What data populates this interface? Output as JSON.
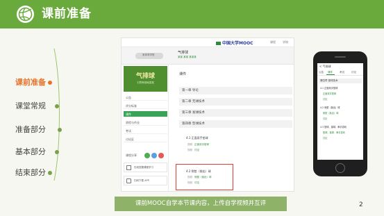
{
  "header": {
    "title": "课前准备"
  },
  "nav": [
    {
      "label": "课前准备",
      "active": true
    },
    {
      "label": "课堂常规",
      "active": false
    },
    {
      "label": "准备部分",
      "active": false
    },
    {
      "label": "基本部分",
      "active": false
    },
    {
      "label": "结束部分",
      "active": false
    }
  ],
  "desktop": {
    "brand": "中国大学MOOC",
    "top_links": [
      "课程",
      "学校"
    ],
    "school_name": "某体育学院",
    "course_name": "气排球",
    "course_sub": "某某 某某 某某某",
    "banner_title": "气排球",
    "banner_sub": "引导有效地发现",
    "sidebar_items": [
      {
        "label": "公告",
        "active": false
      },
      {
        "label": "评分标准",
        "active": false
      },
      {
        "label": "课件",
        "active": true
      },
      {
        "label": "测验与作业",
        "active": false
      },
      {
        "label": "考试",
        "active": false
      },
      {
        "label": "讨论区",
        "active": false
      }
    ],
    "side_share_label": "课程分享",
    "side_card_1": "在线答题课程学习",
    "side_card_2": "扫码下载 APP",
    "content_heading": "课件",
    "chapters": [
      "第一章 导论",
      "第二章 无球技术",
      "第三章 发球技术",
      "第四章 垫球技术"
    ],
    "section_1": "4.1 正面双手垫球",
    "section_1_rows": [
      "正面双手垫球",
      "讨论"
    ],
    "section_2": "4.2 侧垫（抛出）球",
    "section_2_rows": [
      "侧垫（抛出）球",
      "讨论"
    ],
    "row_tag": "视频"
  },
  "phone": {
    "title": "< 气排球",
    "tabs": [
      "公告",
      "课件",
      "考试",
      "讨论"
    ],
    "chapter": "第四章 垫球技术",
    "lines": [
      {
        "text": "4.1 正面双手垫球",
        "green": false
      },
      {
        "text": "正面双手垫球",
        "green": true
      },
      {
        "text": "讨论",
        "green": true
      },
      {
        "text": "4.2 侧垫（抛出）球",
        "green": false
      },
      {
        "text": "侧垫（抛出）球",
        "green": true
      },
      {
        "text": "讨论",
        "green": true
      },
      {
        "text": "4.3 垫球、接球、串手游戏",
        "green": false
      },
      {
        "text": "垫球、接球、串手游戏",
        "green": true
      },
      {
        "text": "讨论",
        "green": true
      }
    ]
  },
  "caption": "课前MOOC自学本节课内容，上传自学视频并互评",
  "page_number": "2",
  "colors": {
    "header_green": "#6aaa3c",
    "accent_orange": "#e8732a",
    "caption_green": "#8fb269"
  }
}
